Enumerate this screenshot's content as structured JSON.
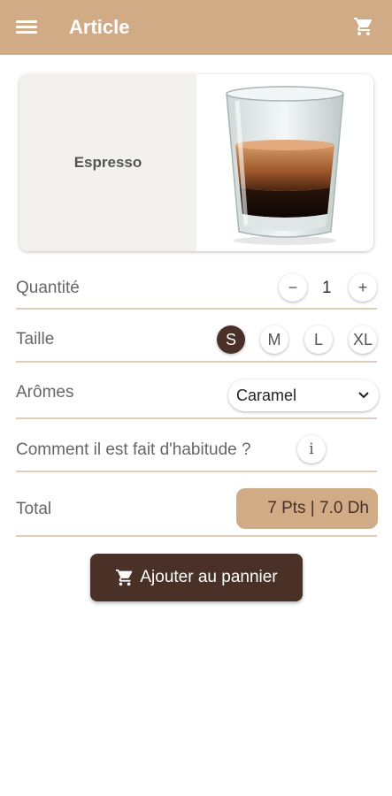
{
  "appbar": {
    "title": "Article",
    "menu_icon": "menu-icon",
    "cart_icon": "cart-icon",
    "color": "#d1aa86"
  },
  "product": {
    "name": "Espresso",
    "image": "espresso-glass-image"
  },
  "quantity": {
    "label": "Quantité",
    "value": "1",
    "decrement": "−",
    "increment": "+"
  },
  "size": {
    "label": "Taille",
    "options": [
      "S",
      "M",
      "L",
      "XL"
    ],
    "selected": "S"
  },
  "aromas": {
    "label": "Arômes",
    "selected": "Caramel"
  },
  "info": {
    "label": "Comment il est fait d'habitude ?",
    "icon": "i"
  },
  "total": {
    "label": "Total",
    "value": "7 Pts | 7.0 Dh"
  },
  "add_button": {
    "label": "Ajouter au pannier",
    "icon": "cart-icon"
  },
  "colors": {
    "accent": "#d1aa86",
    "dark": "#4a3128",
    "divider": "#e3cbb5"
  }
}
